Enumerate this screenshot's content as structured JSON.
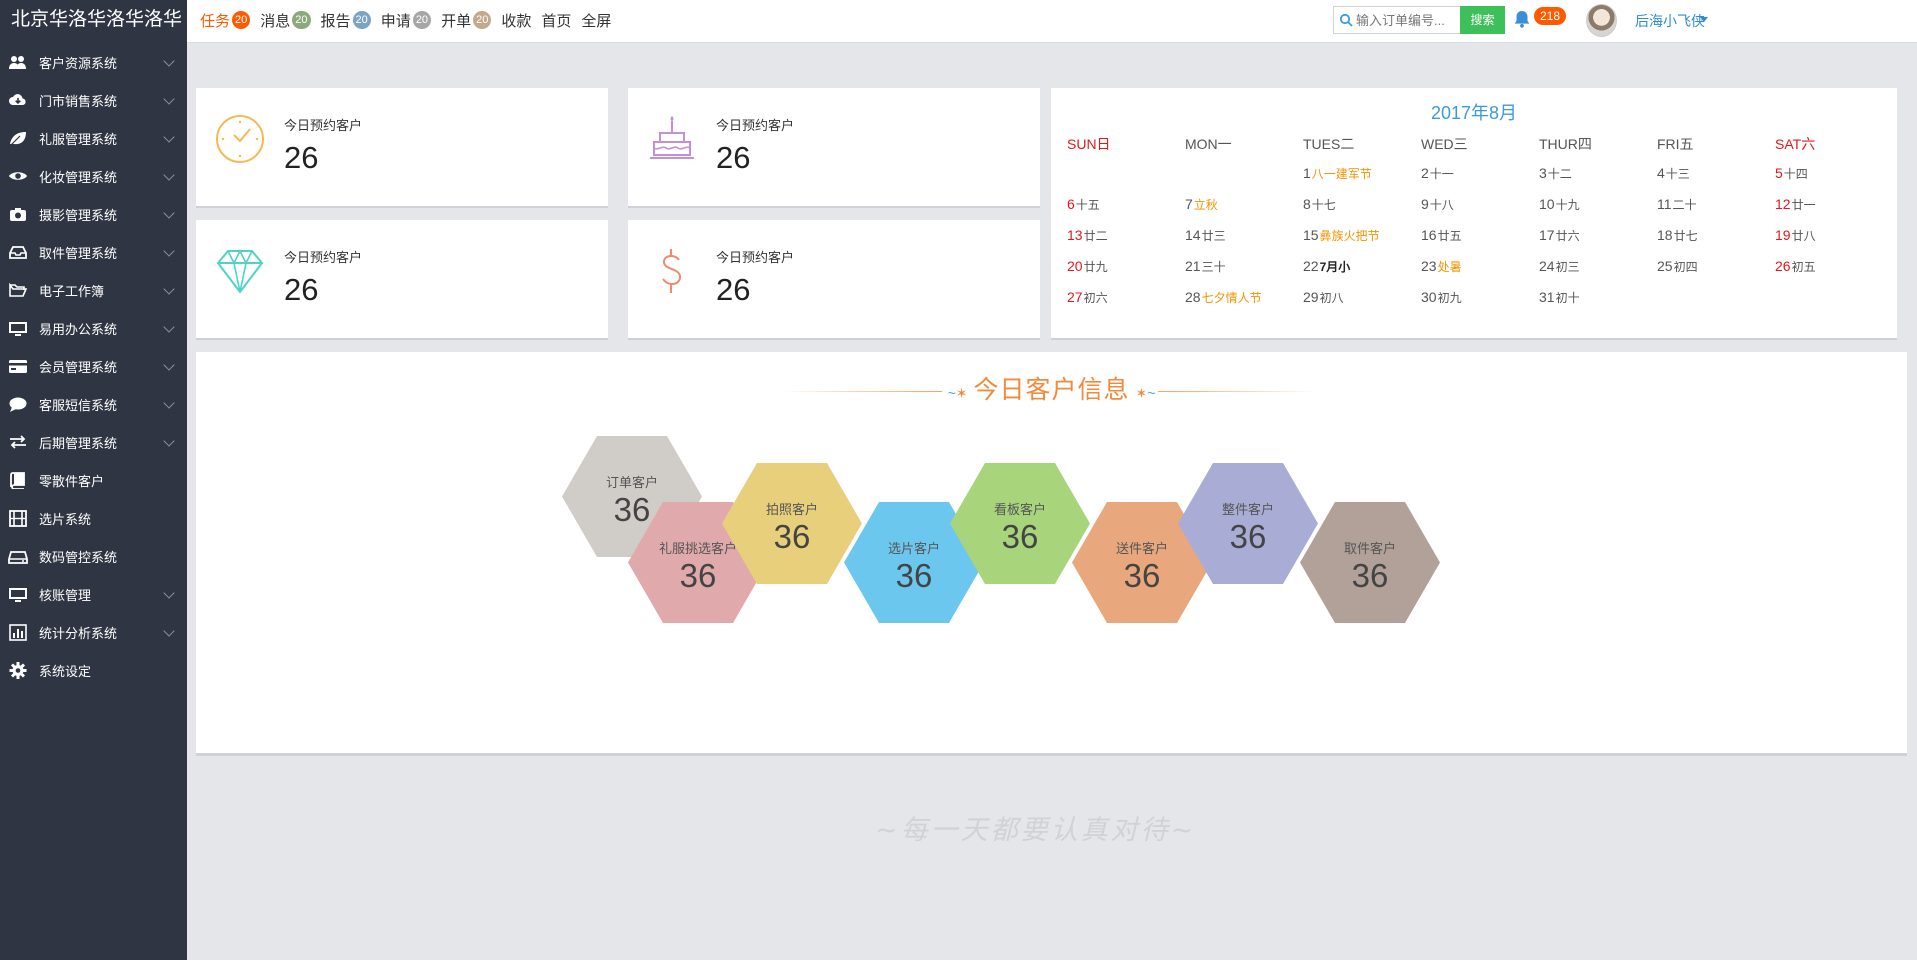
{
  "brand": "北京华洛华洛华洛华",
  "topnav": [
    {
      "label": "任务",
      "badge": "20",
      "badge_color": "#ff5a00",
      "active": true
    },
    {
      "label": "消息",
      "badge": "20",
      "badge_color": "#8aaa7e"
    },
    {
      "label": "报告",
      "badge": "20",
      "badge_color": "#7aa3c4"
    },
    {
      "label": "申请",
      "badge": "20",
      "badge_color": "#a6a6a6"
    },
    {
      "label": "开单",
      "badge": "20",
      "badge_color": "#c4a88c"
    },
    {
      "label": "收款"
    },
    {
      "label": "首页"
    },
    {
      "label": "全屏"
    }
  ],
  "search": {
    "placeholder": "输入订单编号...",
    "button": "搜索"
  },
  "notifications": {
    "count": "218",
    "icon": "bell-icon"
  },
  "user": {
    "name": "后海小飞侠"
  },
  "sidebar": [
    {
      "label": "客户资源系统",
      "icon": "users-icon",
      "expandable": true
    },
    {
      "label": "门市销售系统",
      "icon": "cloud-download-icon",
      "expandable": true
    },
    {
      "label": "礼服管理系统",
      "icon": "leaf-icon",
      "expandable": true
    },
    {
      "label": "化妆管理系统",
      "icon": "eye-icon",
      "expandable": true
    },
    {
      "label": "摄影管理系统",
      "icon": "camera-icon",
      "expandable": true
    },
    {
      "label": "取件管理系统",
      "icon": "inbox-icon",
      "expandable": true
    },
    {
      "label": "电子工作簿",
      "icon": "folder-open-icon",
      "expandable": true
    },
    {
      "label": "易用办公系统",
      "icon": "monitor-icon",
      "expandable": true
    },
    {
      "label": "会员管理系统",
      "icon": "credit-card-icon",
      "expandable": true
    },
    {
      "label": "客服短信系统",
      "icon": "comment-icon",
      "expandable": true
    },
    {
      "label": "后期管理系统",
      "icon": "exchange-icon",
      "expandable": true
    },
    {
      "label": "零散件客户",
      "icon": "book-icon",
      "expandable": false
    },
    {
      "label": "选片系统",
      "icon": "film-icon",
      "expandable": false
    },
    {
      "label": "数码管控系统",
      "icon": "hdd-icon",
      "expandable": false
    },
    {
      "label": "核账管理",
      "icon": "desktop-icon",
      "expandable": true
    },
    {
      "label": "统计分析系统",
      "icon": "bar-chart-icon",
      "expandable": true
    },
    {
      "label": "系统设定",
      "icon": "gear-icon",
      "expandable": false
    }
  ],
  "stats": [
    {
      "label": "今日预约客户",
      "value": "26",
      "icon": "clock-icon",
      "color": "#f7b955"
    },
    {
      "label": "今日预约客户",
      "value": "26",
      "icon": "cake-icon",
      "color": "#c58fd6"
    },
    {
      "label": "今日预约客户",
      "value": "26",
      "icon": "diamond-icon",
      "color": "#4fd3c2"
    },
    {
      "label": "今日预约客户",
      "value": "26",
      "icon": "dollar-icon",
      "color": "#f08a6a"
    }
  ],
  "calendar": {
    "title": "2017年8月",
    "weekdays": [
      "SUN日",
      "MON一",
      "TUES二",
      "WED三",
      "THUR四",
      "FRI五",
      "SAT六"
    ],
    "weeks": [
      [
        null,
        null,
        {
          "d": "1",
          "l": "八一建军节",
          "hol": true
        },
        {
          "d": "2",
          "l": "十一"
        },
        {
          "d": "3",
          "l": "十二"
        },
        {
          "d": "4",
          "l": "十三"
        },
        {
          "d": "5",
          "l": "十四"
        }
      ],
      [
        {
          "d": "6",
          "l": "十五"
        },
        {
          "d": "7",
          "l": "立秋",
          "hol": true
        },
        {
          "d": "8",
          "l": "十七"
        },
        {
          "d": "9",
          "l": "十八"
        },
        {
          "d": "10",
          "l": "十九"
        },
        {
          "d": "11",
          "l": "二十"
        },
        {
          "d": "12",
          "l": "廿一"
        }
      ],
      [
        {
          "d": "13",
          "l": "廿二"
        },
        {
          "d": "14",
          "l": "廿三"
        },
        {
          "d": "15",
          "l": "彝族火把节",
          "hol": true
        },
        {
          "d": "16",
          "l": "廿五"
        },
        {
          "d": "17",
          "l": "廿六"
        },
        {
          "d": "18",
          "l": "廿七"
        },
        {
          "d": "19",
          "l": "廿八"
        }
      ],
      [
        {
          "d": "20",
          "l": "廿九"
        },
        {
          "d": "21",
          "l": "三十"
        },
        {
          "d": "22",
          "l": "7月小",
          "bold": true
        },
        {
          "d": "23",
          "l": "处暑",
          "hol": true
        },
        {
          "d": "24",
          "l": "初三"
        },
        {
          "d": "25",
          "l": "初四"
        },
        {
          "d": "26",
          "l": "初五"
        }
      ],
      [
        {
          "d": "27",
          "l": "初六"
        },
        {
          "d": "28",
          "l": "七夕情人节",
          "hol": true
        },
        {
          "d": "29",
          "l": "初八"
        },
        {
          "d": "30",
          "l": "初九"
        },
        {
          "d": "31",
          "l": "初十"
        },
        null,
        null
      ]
    ]
  },
  "info": {
    "title": "今日客户信息",
    "hexes": [
      {
        "label": "订单客户",
        "value": "36",
        "color": "#d0ccc8"
      },
      {
        "label": "礼服挑选客户",
        "value": "36",
        "color": "#e0a9ab"
      },
      {
        "label": "拍照客户",
        "value": "36",
        "color": "#e8cf7c"
      },
      {
        "label": "选片客户",
        "value": "36",
        "color": "#6cc7ef"
      },
      {
        "label": "看板客户",
        "value": "36",
        "color": "#a8d47b"
      },
      {
        "label": "送件客户",
        "value": "36",
        "color": "#e8a77c"
      },
      {
        "label": "整件客户",
        "value": "36",
        "color": "#a9add6"
      },
      {
        "label": "取件客户",
        "value": "36",
        "color": "#b2a199"
      }
    ]
  },
  "motto": "~每一天都要认真对待~"
}
